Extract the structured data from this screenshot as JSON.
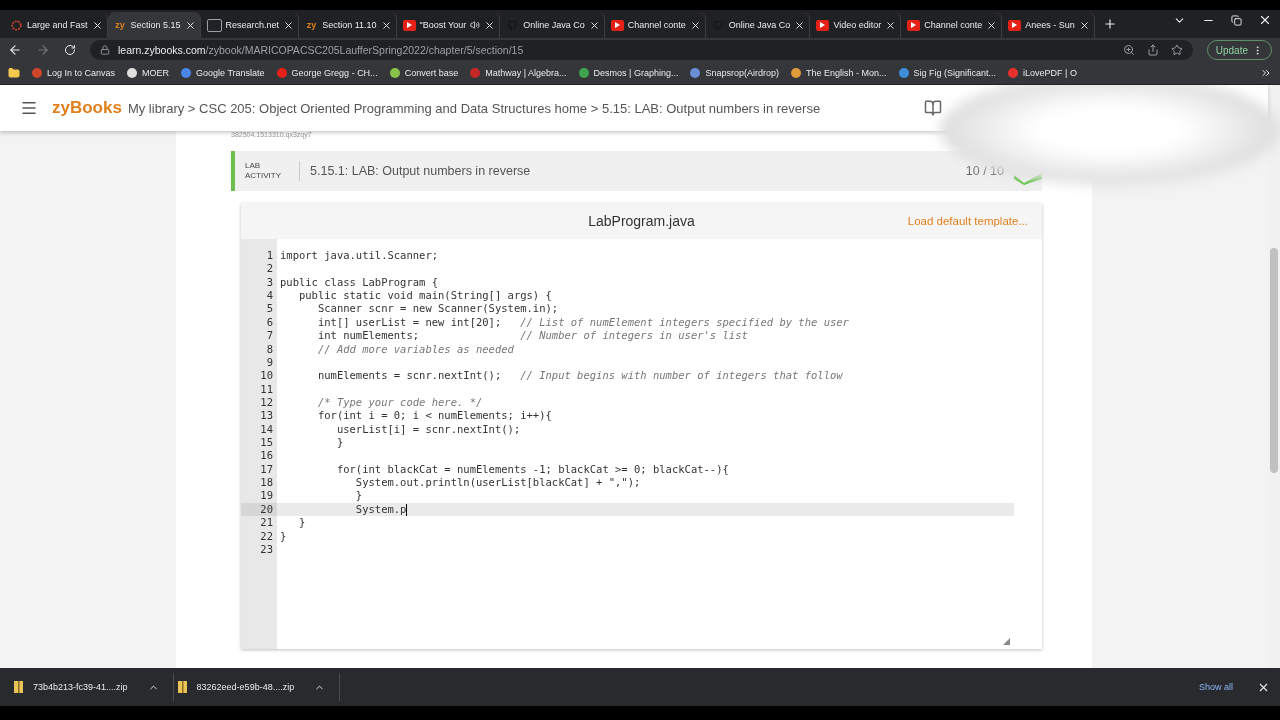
{
  "browser": {
    "tabs": [
      {
        "title": "Large and Fast",
        "kind": "ring",
        "selected": false,
        "audio": false
      },
      {
        "title": "Section 5.15",
        "kind": "zy",
        "selected": true,
        "audio": false
      },
      {
        "title": "Research.net",
        "kind": "research",
        "selected": false,
        "audio": false
      },
      {
        "title": "Section 11.10",
        "kind": "zy",
        "selected": false,
        "audio": false
      },
      {
        "title": "\"Boost Your",
        "kind": "youtube",
        "selected": false,
        "audio": true
      },
      {
        "title": "Online Java Co",
        "kind": "github",
        "selected": false,
        "audio": false
      },
      {
        "title": "Channel conte",
        "kind": "youtube",
        "selected": false,
        "audio": false
      },
      {
        "title": "Online Java Co",
        "kind": "github",
        "selected": false,
        "audio": false
      },
      {
        "title": "Video editor",
        "kind": "youtube",
        "selected": false,
        "audio": false
      },
      {
        "title": "Channel conte",
        "kind": "youtube",
        "selected": false,
        "audio": false
      },
      {
        "title": "Anees - Sun",
        "kind": "youtube",
        "selected": false,
        "audio": false
      }
    ],
    "address": {
      "host": "learn.zybooks.com",
      "path": "/zybook/MARICOPACSC205LaufferSpring2022/chapter/5/section/15"
    },
    "update_button": "Update",
    "bookmarks": [
      {
        "label": "Log In to Canvas",
        "color": "#d2452d"
      },
      {
        "label": "MOER",
        "color": "#e0e0e0"
      },
      {
        "label": "Google Translate",
        "color": "#4a86e8"
      },
      {
        "label": "George Gregg - CH...",
        "color": "#e62117"
      },
      {
        "label": "Convert base",
        "color": "#8bc34a"
      },
      {
        "label": "Mathway | Algebra...",
        "color": "#c62828"
      },
      {
        "label": "Desmos | Graphing...",
        "color": "#3fa34d"
      },
      {
        "label": "Snapsrop(Airdrop)",
        "color": "#6b8fd6"
      },
      {
        "label": "The English - Mon...",
        "color": "#e09b3d"
      },
      {
        "label": "Sig Fig (Significant...",
        "color": "#3b8fd9"
      },
      {
        "label": "iLovePDF | O",
        "color": "#e5322d"
      }
    ]
  },
  "page": {
    "logo": "zyBooks",
    "breadcrumb": "My library > CSC 205: Object Oriented Programming and Data Structures home > 5.15: LAB: Output numbers in reverse",
    "faint_id": "382504.1513310.qx3zqy7",
    "activity": {
      "label": "LAB ACTIVITY",
      "title": "5.15.1: LAB: Output numbers in reverse",
      "score": "10 / 10"
    },
    "editor": {
      "filename": "LabProgram.java",
      "template_link": "Load default template...",
      "lines": [
        {
          "number": "1",
          "kind": "code",
          "code": "import java.util.Scanner;",
          "current": false
        },
        {
          "number": "2",
          "kind": "code",
          "current": false
        },
        {
          "number": "3",
          "kind": "code",
          "code": "public class LabProgram {",
          "current": false
        },
        {
          "number": "4",
          "kind": "code",
          "code": "   public static void main(String[] args) {",
          "current": false
        },
        {
          "number": "5",
          "kind": "code",
          "code": "      Scanner scnr = new Scanner(System.in);",
          "current": false
        },
        {
          "number": "6",
          "kind": "code",
          "code": "      int[] userList = new int[20];",
          "comment": "// List of numElement integers specified by the user",
          "current": false
        },
        {
          "number": "7",
          "kind": "code",
          "code": "      int numElements;",
          "comment": "// Number of integers in user's list",
          "current": false
        },
        {
          "number": "8",
          "kind": "comment",
          "code": "      // Add more variables as needed",
          "current": false
        },
        {
          "number": "9",
          "kind": "code",
          "current": false
        },
        {
          "number": "10",
          "kind": "code",
          "code": "      numElements = scnr.nextInt();",
          "comment": "// Input begins with number of integers that follow",
          "current": false
        },
        {
          "number": "11",
          "kind": "code",
          "current": false
        },
        {
          "number": "12",
          "kind": "comment",
          "code": "      /* Type your code here. */",
          "current": false
        },
        {
          "number": "13",
          "kind": "code",
          "code": "      for(int i = 0; i < numElements; i++){",
          "current": false
        },
        {
          "number": "14",
          "kind": "code",
          "code": "         userList[i] = scnr.nextInt();",
          "current": false
        },
        {
          "number": "15",
          "kind": "code",
          "code": "         }",
          "current": false
        },
        {
          "number": "16",
          "kind": "code",
          "current": false
        },
        {
          "number": "17",
          "kind": "code",
          "code": "         for(int blackCat = numElements -1; blackCat >= 0; blackCat--){",
          "current": false
        },
        {
          "number": "18",
          "kind": "code",
          "code": "            System.out.println(userList[blackCat] + \",\");",
          "current": false
        },
        {
          "number": "19",
          "kind": "code",
          "code": "            }",
          "current": false
        },
        {
          "number": "20",
          "kind": "code",
          "code": "            System.p",
          "current": true
        },
        {
          "number": "21",
          "kind": "code",
          "code": "   }",
          "current": false
        },
        {
          "number": "22",
          "kind": "code",
          "code": "}",
          "current": false
        },
        {
          "number": "23",
          "kind": "code",
          "current": false
        }
      ]
    }
  },
  "downloads": {
    "items": [
      {
        "name": "73b4b213-fc39-41....zip"
      },
      {
        "name": "83262eed-e59b-48....zip"
      }
    ],
    "show_all": "Show all"
  }
}
